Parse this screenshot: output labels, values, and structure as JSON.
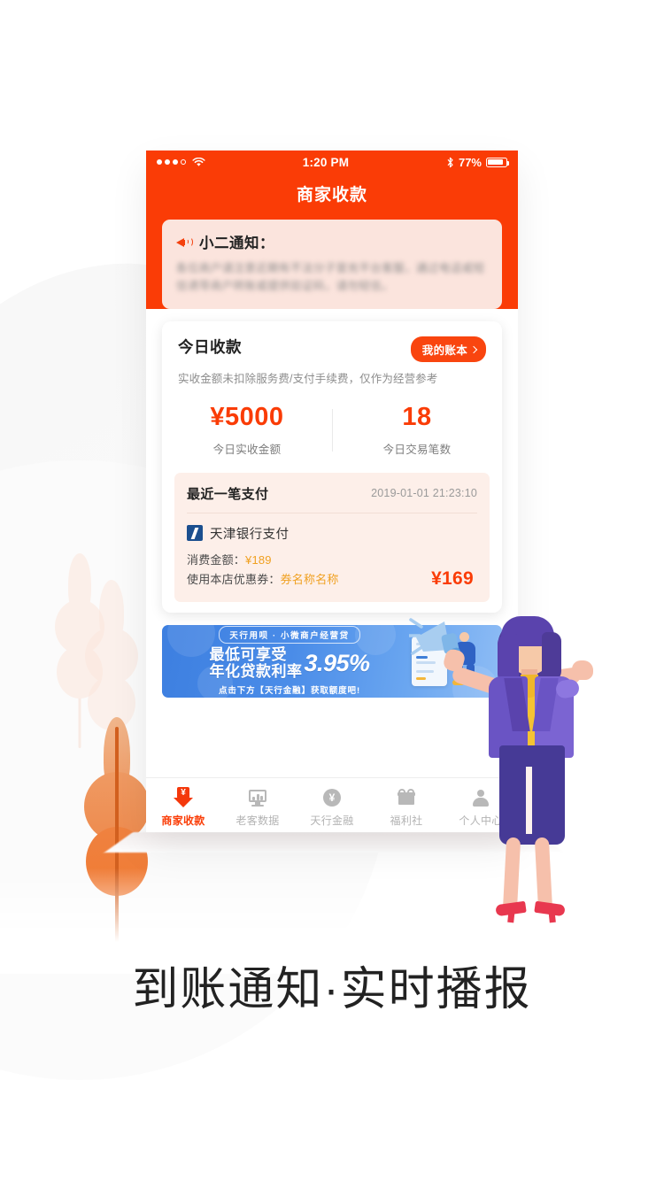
{
  "headline": "到账通知·实时播报",
  "phone": {
    "statusbar": {
      "signal_icon": "signal-dots-icon",
      "wifi_icon": "wifi-icon",
      "time": "1:20 PM",
      "bluetooth_icon": "bluetooth-icon",
      "battery_percent": "77%",
      "battery_icon": "battery-icon"
    },
    "nav": {
      "title": "商家收款"
    },
    "notice": {
      "speaker_icon": "speaker-icon",
      "title": "小二通知：",
      "body": "各位商户请注意近期有不法分子冒充平台客服，通过电话或短信诱导商户转账或提供验证码，请勿轻信。"
    },
    "today": {
      "title": "今日收款",
      "ledger_button": "我的账本",
      "chevron_icon": "chevron-right-icon",
      "subtitle": "实收金额未扣除服务费/支付手续费，仅作为经营参考",
      "stats": [
        {
          "value": "¥5000",
          "label": "今日实收金额"
        },
        {
          "value": "18",
          "label": "今日交易笔数"
        }
      ]
    },
    "recent": {
      "title": "最近一笔支付",
      "time": "2019-01-01 21:23:10",
      "bank_logo_icon": "bank-logo-icon",
      "method": "天津银行支付",
      "amount_label": "消费金额：",
      "amount_value": "¥189",
      "coupon_label": "使用本店优惠券：",
      "coupon_value": "券名称名称",
      "total": "¥169"
    },
    "banner": {
      "tag": "天行用呗 · 小微商户经营贷",
      "line1": "最低可享受",
      "line2": "年化贷款利率",
      "rate": "3.95%",
      "cta": "点击下方【天行金融】获取额度吧!"
    },
    "tabbar": [
      {
        "icon": "pay-arrow-icon",
        "label": "商家收款",
        "active": true
      },
      {
        "icon": "bar-chart-icon",
        "label": "老客数据",
        "active": false
      },
      {
        "icon": "yen-circle-icon",
        "label": "天行金融",
        "active": false
      },
      {
        "icon": "gift-icon",
        "label": "福利社",
        "active": false
      },
      {
        "icon": "person-icon",
        "label": "个人中心",
        "active": false
      }
    ]
  },
  "illustration": {
    "character": "woman-with-megaphone",
    "megaphone_icon": "megaphone-icon"
  },
  "colors": {
    "brand_orange": "#fa3c06",
    "notice_bg": "#fbe4dd",
    "recent_bg": "#fdefe9",
    "banner_blue": "#4a8ce8",
    "coupon_yellow": "#f0a020",
    "bank_blue": "#1b4f8f",
    "tab_inactive": "#b3b3b3"
  }
}
